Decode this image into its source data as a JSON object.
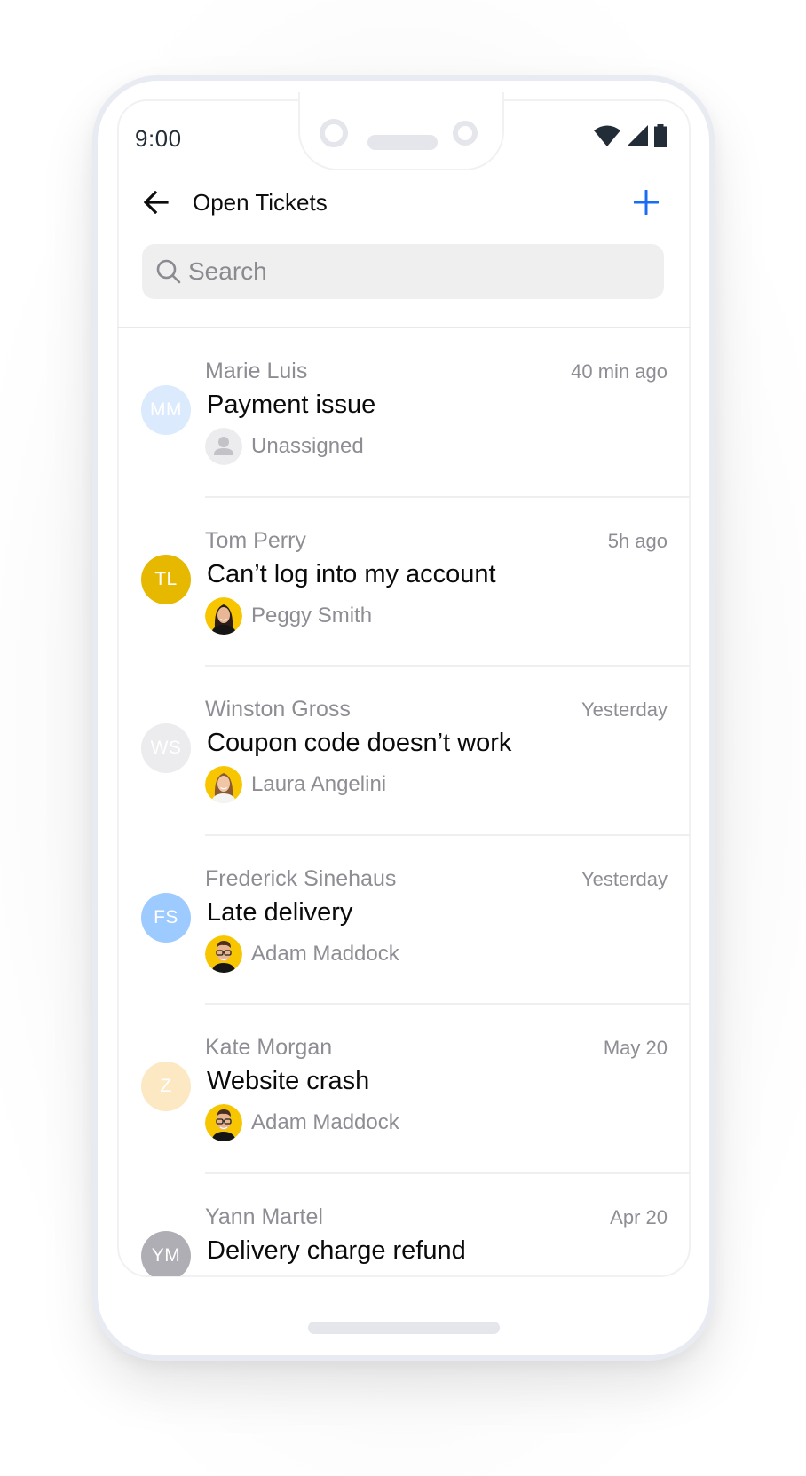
{
  "status_bar": {
    "time": "9:00",
    "icons": [
      "wifi-icon",
      "signal-icon",
      "battery-icon"
    ]
  },
  "header": {
    "back_icon": "arrow-left-icon",
    "title": "Open Tickets",
    "add_icon": "plus-icon"
  },
  "search": {
    "placeholder": "Search",
    "value": "",
    "icon": "search-icon"
  },
  "colors": {
    "accent": "#1a6cf5",
    "text_primary": "#0a0a0a",
    "text_secondary": "#8d8d94",
    "search_bg": "#efefef"
  },
  "tickets": [
    {
      "initials": "MM",
      "avatar_color": "#dbeafd",
      "customer": "Marie Luis",
      "time": "40 min ago",
      "subject": "Payment issue",
      "assignee": "Unassigned",
      "assignee_avatar": "person-placeholder-icon"
    },
    {
      "initials": "TL",
      "avatar_color": "#e6b800",
      "customer": "Tom Perry",
      "time": "5h ago",
      "subject": "Can’t log into my account",
      "assignee": "Peggy Smith",
      "assignee_avatar": "photo-female-dark-hair"
    },
    {
      "initials": "WS",
      "avatar_color": "#ececee",
      "customer": "Winston Gross",
      "time": "Yesterday",
      "subject": "Coupon code doesn’t work",
      "assignee": "Laura Angelini",
      "assignee_avatar": "photo-female-light-hair"
    },
    {
      "initials": "FS",
      "avatar_color": "#9ecbff",
      "customer": "Frederick Sinehaus",
      "time": "Yesterday",
      "subject": "Late delivery",
      "assignee": "Adam Maddock",
      "assignee_avatar": "photo-male-glasses"
    },
    {
      "initials": "Z",
      "avatar_color": "#fde8c4",
      "customer": "Kate Morgan",
      "time": "May 20",
      "subject": "Website crash",
      "assignee": "Adam Maddock",
      "assignee_avatar": "photo-male-glasses"
    },
    {
      "initials": "YM",
      "avatar_color": "#aeaeb4",
      "customer": "Yann Martel",
      "time": "Apr 20",
      "subject": "Delivery charge refund",
      "assignee": null,
      "assignee_avatar": null
    }
  ]
}
